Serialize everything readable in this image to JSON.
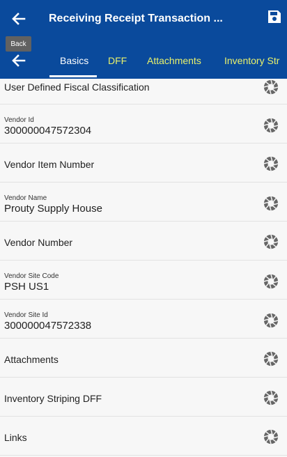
{
  "header": {
    "title": "Receiving Receipt Transaction ...",
    "tooltip": "Back"
  },
  "tabs": [
    {
      "label": "Basics",
      "active": true
    },
    {
      "label": "DFF",
      "active": false
    },
    {
      "label": "Attachments",
      "active": false
    },
    {
      "label": "Inventory Str",
      "active": false
    }
  ],
  "rows": [
    {
      "label": "User Defined Fiscal Classification"
    },
    {
      "label": "Vendor Id",
      "value": "300000047572304"
    },
    {
      "label": "Vendor Item Number"
    },
    {
      "label": "Vendor Name",
      "value": "Prouty Supply House"
    },
    {
      "label": "Vendor Number"
    },
    {
      "label": "Vendor Site Code",
      "value": "PSH US1"
    },
    {
      "label": "Vendor Site Id",
      "value": "300000047572338"
    },
    {
      "label": "Attachments"
    },
    {
      "label": "Inventory Striping DFF"
    },
    {
      "label": "Links"
    }
  ],
  "colors": {
    "header_bg": "#0a4a9c",
    "active_tab": "#ffffff",
    "inactive_tab": "#e9f16b"
  },
  "icons": {
    "back": "arrow-left-icon",
    "save": "save-icon",
    "row_action": "shutter-icon"
  }
}
